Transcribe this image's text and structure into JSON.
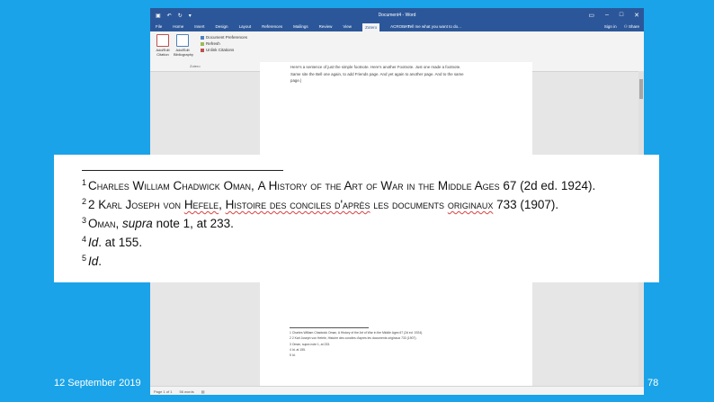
{
  "window": {
    "title": "Document4 - Word",
    "qat_icons": [
      "save-icon",
      "undo-icon",
      "redo-icon",
      "customize-icon"
    ]
  },
  "tabs": [
    "File",
    "Home",
    "Insert",
    "Design",
    "Layout",
    "References",
    "Mailings",
    "Review",
    "View",
    "Zotero",
    "ACROBAT"
  ],
  "active_tab": "Zotero",
  "tell_me": "Tell me what you want to do...",
  "account": {
    "sign_in": "Sign in",
    "share": "Share"
  },
  "ribbon": {
    "add_citation": "Add/Edit Citation",
    "add_bibliography": "Add/Edit Bibliography",
    "document_preferences": "Document Preferences",
    "refresh": "Refresh",
    "unlink_citations": "Unlink Citations",
    "group_label": "Zotero"
  },
  "document": {
    "body_lines": [
      "Here's a sentence of just the simple footnote. Here's another Footnote. Just one made a footnote.",
      "Same site the Bell one again, to add Friends page. And yet again to another page. And to the same",
      "page.|"
    ],
    "small_footnotes": [
      "1 Charles William Chadwick Oman, A History of the Art of War in the Middle Ages 67 (2d ed. 1924).",
      "2 2 Karl Joseph von Hefele, Histoire des conciles d'après les documents originaux 733 (1907).",
      "3 Oman, supra note 1, at 233.",
      "4 Id. at 155.",
      "5 Id."
    ]
  },
  "status": {
    "page": "Page 1 of 1",
    "words": "56 words"
  },
  "callout": {
    "footnotes": [
      {
        "num": "1",
        "author": "Charles William Chadwick Oman",
        "sep": ", ",
        "title": "A History of the Art of War in the Middle Ages",
        "rest": " 67 (2d ed. 1924)."
      },
      {
        "num": "2",
        "author_pre": "2 Karl Joseph von ",
        "author_squig": "Hefele",
        "sep": ", ",
        "title_squig": "Histoire des conciles d'après",
        "title_plain": " les documents ",
        "title_squig2": "originaux",
        "rest": " 733 (1907)."
      },
      {
        "num": "3",
        "author": "Oman",
        "sep": ", ",
        "italic": "supra",
        "rest": " note 1, at 233."
      },
      {
        "num": "4",
        "italic": "Id",
        "rest": ". at 155."
      },
      {
        "num": "5",
        "italic": "Id",
        "rest": "."
      }
    ]
  },
  "slide": {
    "date": "12 September 2019",
    "page_number": "78"
  }
}
